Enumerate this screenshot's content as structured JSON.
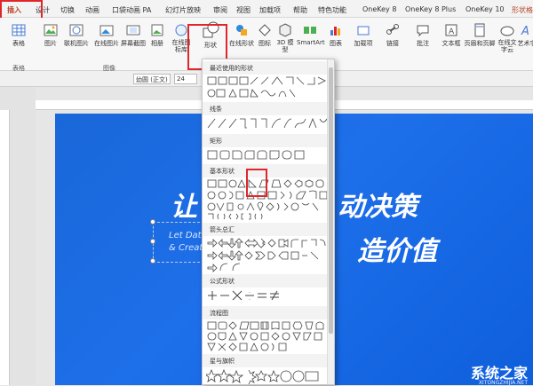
{
  "tabs": [
    "插入",
    "设计",
    "切换",
    "动画",
    "口袋动画 PA",
    "幻灯片放映",
    "审阅",
    "视图",
    "加载项",
    "帮助",
    "特色功能",
    "OneKey 8",
    "OneKey 8 Plus",
    "OneKey 10",
    "形状格"
  ],
  "ribbon": {
    "buttons": [
      {
        "label": "表格"
      },
      {
        "label": "图片"
      },
      {
        "label": "联机图片"
      },
      {
        "label": "在线图片"
      },
      {
        "label": "屏幕截图"
      },
      {
        "label": "相册"
      },
      {
        "label": "在线图标库"
      },
      {
        "label": "形状"
      },
      {
        "label": "在线形状"
      },
      {
        "label": "图标"
      },
      {
        "label": "3D 模型"
      },
      {
        "label": "SmartArt"
      },
      {
        "label": "图表"
      },
      {
        "label": "加载项"
      },
      {
        "label": "链接"
      },
      {
        "label": "批注"
      },
      {
        "label": "文本框"
      },
      {
        "label": "页眉和页脚"
      },
      {
        "label": "在线文字云"
      },
      {
        "label": "艺术字"
      }
    ],
    "groups": {
      "tables": "表格",
      "images": "图像"
    }
  },
  "format_bar": {
    "font": "幼圆 (正文)",
    "size": "24"
  },
  "dropdown": {
    "sections": [
      "最近使用的形状",
      "线条",
      "矩形",
      "基本形状",
      "箭头总汇",
      "公式形状",
      "流程图",
      "星与旗帜"
    ]
  },
  "slide": {
    "title1_left": "让",
    "title1_right": "动决策",
    "title2_right": "造价值",
    "sub1": "Let Data",
    "sub2": "& Creat"
  },
  "watermark": {
    "text": "系统之家",
    "url": "XITONGZHIJIA.NET"
  },
  "colors": {
    "accent_red": "#e0262a",
    "slide_blue": "#1e6fea"
  }
}
